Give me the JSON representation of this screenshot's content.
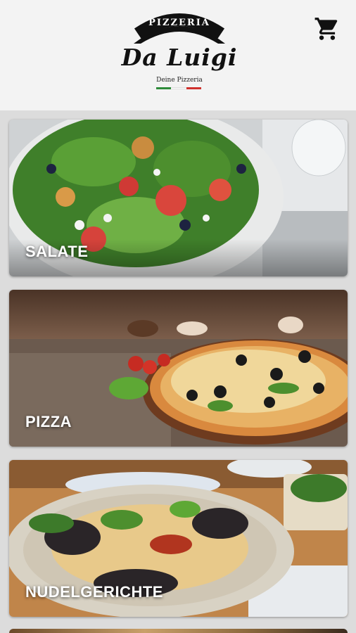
{
  "header": {
    "brand_top": "PIZZERIA",
    "brand_name": "Da Luigi",
    "brand_sub": "Deine Pizzeria",
    "cart_icon": "shopping-cart-icon",
    "flag_colors": [
      "#2e8b3a",
      "#ffffff",
      "#d0312d"
    ]
  },
  "categories": [
    {
      "label": "SALATE",
      "image": "salad-photo"
    },
    {
      "label": "PIZZA",
      "image": "pizza-photo"
    },
    {
      "label": "NUDELGERICHTE",
      "image": "pasta-photo"
    }
  ],
  "colors": {
    "header_bg": "#f3f3f3",
    "page_bg": "#dcdcdc",
    "label_text": "#ffffff",
    "brand_dark": "#111111"
  }
}
